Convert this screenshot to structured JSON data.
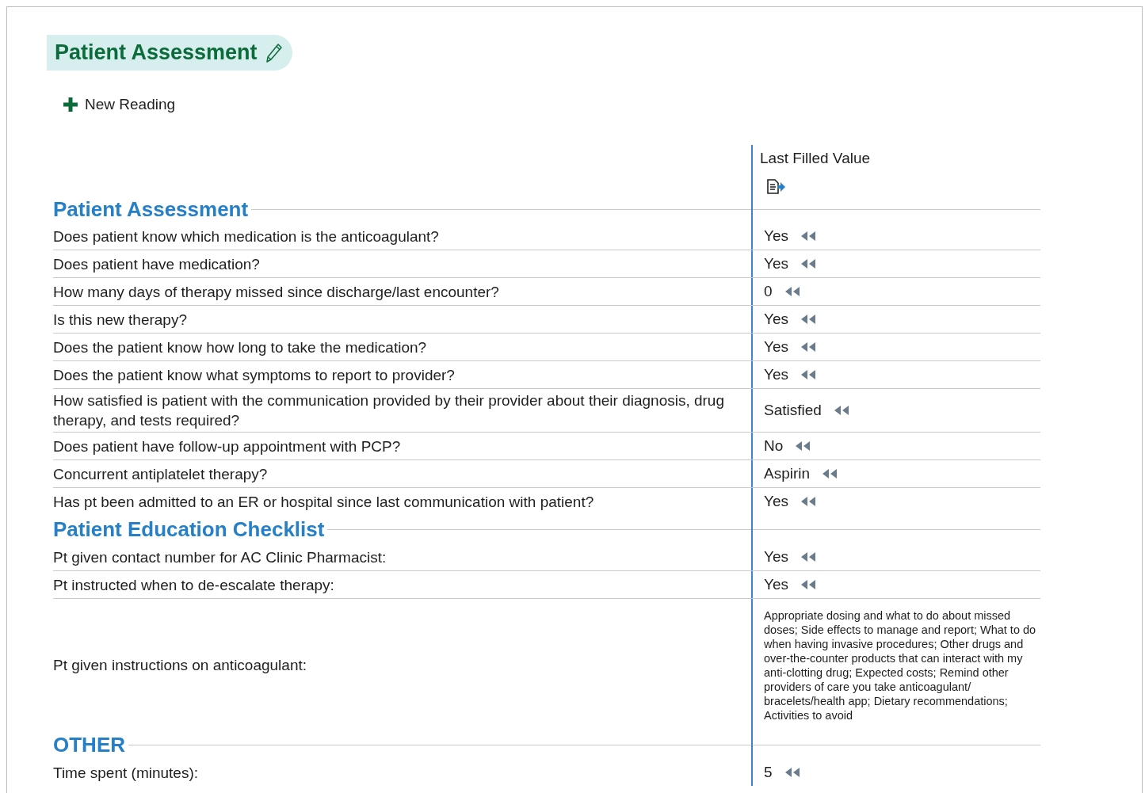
{
  "title": "Patient Assessment",
  "new_reading": "New Reading",
  "value_column": "Last Filled Value",
  "sections": [
    {
      "heading": "Patient Assessment",
      "rows": [
        {
          "question": "Does patient know which medication is the anticoagulant?",
          "value": "Yes",
          "kind": "short"
        },
        {
          "question": "Does patient  have medication?",
          "value": "Yes",
          "kind": "short"
        },
        {
          "question": "How many days of therapy missed since discharge/last encounter?",
          "value": "0",
          "kind": "short"
        },
        {
          "question": "Is this new therapy?",
          "value": "Yes",
          "kind": "short"
        },
        {
          "question": "Does the patient know how long to take the medication?",
          "value": "Yes",
          "kind": "short"
        },
        {
          "question": "Does the patient know what symptoms to report to provider?",
          "value": "Yes",
          "kind": "short"
        },
        {
          "question": "How satisfied is patient with the communication provided by their provider about their diagnosis, drug therapy, and tests required?",
          "value": "Satisfied",
          "kind": "short"
        },
        {
          "question": "Does patient have follow-up appointment with PCP?",
          "value": "No",
          "kind": "short"
        },
        {
          "question": "Concurrent antiplatelet therapy?",
          "value": "Aspirin",
          "kind": "short"
        },
        {
          "question": "Has pt been admitted to an ER or hospital since last communication with patient?",
          "value": "Yes",
          "kind": "short"
        }
      ]
    },
    {
      "heading": "Patient Education Checklist",
      "rows": [
        {
          "question": "Pt given contact number for AC Clinic Pharmacist:",
          "value": "Yes",
          "kind": "short"
        },
        {
          "question": "Pt instructed when to de-escalate therapy:",
          "value": "Yes",
          "kind": "short"
        },
        {
          "question": "Pt given instructions on anticoagulant:",
          "value": "Appropriate dosing and what to do about missed doses; Side effects to manage and report; What to do when having invasive procedures; Other drugs and over-the-counter products that can interact with my anti-clotting drug; Expected costs; Remind other providers of care you take anticoagulant/ bracelets/health app; Dietary recommendations; Activities to avoid",
          "kind": "long"
        }
      ]
    },
    {
      "heading": "OTHER",
      "rows": [
        {
          "question": "Time spent (minutes):",
          "value": "5",
          "kind": "short"
        }
      ]
    }
  ]
}
